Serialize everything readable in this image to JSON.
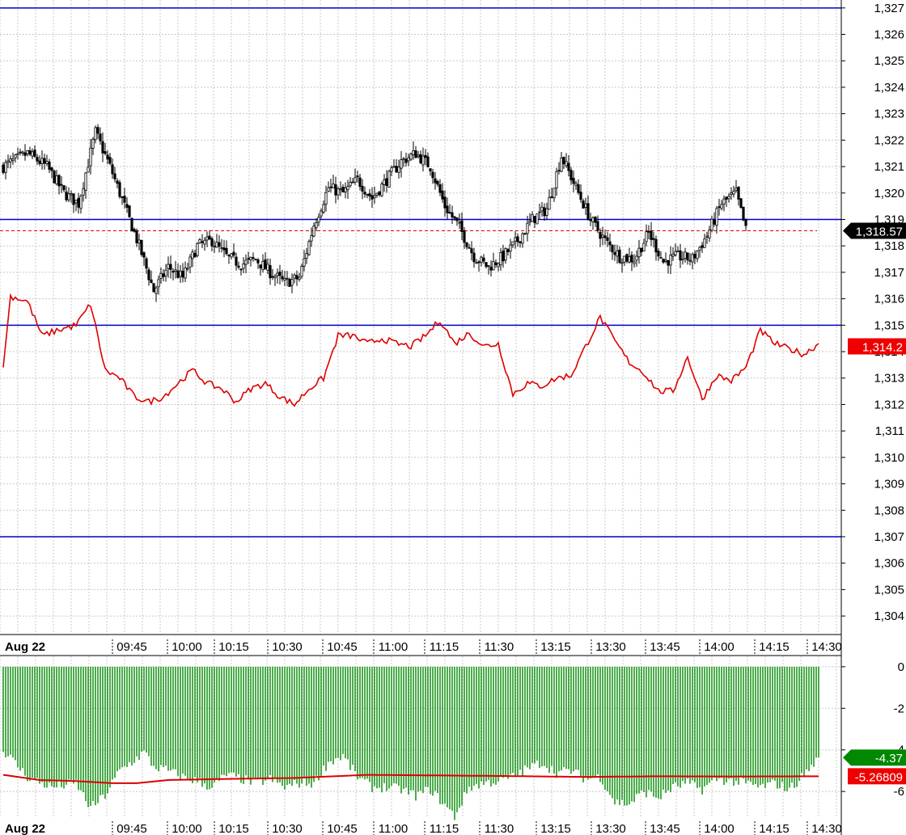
{
  "colors": {
    "grid": "#c8c8c8",
    "level_line": "#0000cc",
    "candle": "#000000",
    "price_line": "#dd0000",
    "volume_bar": "#008800",
    "avg_line": "#dd0000"
  },
  "time_axis": {
    "date_label": "Aug 22",
    "labels": [
      "09:45",
      "10:00",
      "10:15",
      "10:30",
      "10:45",
      "11:00",
      "11:15",
      "11:30",
      "13:15",
      "13:30",
      "13:45",
      "14:00",
      "14:15",
      "14:30"
    ]
  },
  "chart_data": [
    {
      "type": "candlestick",
      "y_ticks": [
        "1,327",
        "1,326",
        "1,325",
        "1,324",
        "1,323",
        "1,322",
        "1,321",
        "1,320",
        "1,319",
        "1,318",
        "1,317",
        "1,316",
        "1,315",
        "1,314",
        "1,313",
        "1,312",
        "1,311",
        "1,310",
        "1,309",
        "1,308",
        "1,307",
        "1,306",
        "1,305",
        "1,304"
      ],
      "ylim": [
        1303.3,
        1327.3
      ],
      "horizontal_levels": [
        1327,
        1319,
        1315,
        1307
      ],
      "dashed_level": 1318.57,
      "price_badge": "1,318.57",
      "line_badge": "1,314.2",
      "close_anchors": [
        [
          0,
          1321.0
        ],
        [
          10,
          1321.5
        ],
        [
          18,
          1321.0
        ],
        [
          25,
          1320.0
        ],
        [
          31,
          1319.6
        ],
        [
          38,
          1322.3
        ],
        [
          44,
          1321.0
        ],
        [
          50,
          1319.5
        ],
        [
          56,
          1318.0
        ],
        [
          62,
          1316.3
        ],
        [
          68,
          1317.2
        ],
        [
          74,
          1316.8
        ],
        [
          80,
          1318.0
        ],
        [
          86,
          1318.2
        ],
        [
          92,
          1317.6
        ],
        [
          98,
          1317.3
        ],
        [
          104,
          1317.5
        ],
        [
          110,
          1317.0
        ],
        [
          116,
          1316.6
        ],
        [
          122,
          1316.8
        ],
        [
          128,
          1318.8
        ],
        [
          134,
          1320.2
        ],
        [
          140,
          1320.0
        ],
        [
          146,
          1320.5
        ],
        [
          152,
          1319.8
        ],
        [
          158,
          1320.5
        ],
        [
          164,
          1321.2
        ],
        [
          170,
          1321.5
        ],
        [
          176,
          1321.0
        ],
        [
          182,
          1319.5
        ],
        [
          188,
          1318.7
        ],
        [
          194,
          1317.6
        ],
        [
          200,
          1317.2
        ],
        [
          206,
          1317.6
        ],
        [
          212,
          1318.2
        ],
        [
          218,
          1319.0
        ],
        [
          224,
          1319.4
        ],
        [
          230,
          1321.4
        ],
        [
          236,
          1320.2
        ],
        [
          242,
          1319.0
        ],
        [
          248,
          1318.2
        ],
        [
          254,
          1317.6
        ],
        [
          260,
          1317.5
        ],
        [
          266,
          1318.5
        ],
        [
          272,
          1317.4
        ],
        [
          278,
          1317.6
        ],
        [
          284,
          1317.5
        ],
        [
          290,
          1318.4
        ],
        [
          296,
          1319.6
        ],
        [
          302,
          1320.0
        ],
        [
          306,
          1318.6
        ]
      ],
      "line_series": {
        "name": "",
        "anchors": [
          [
            0,
            1313.4
          ],
          [
            3,
            1316.1
          ],
          [
            10,
            1315.9
          ],
          [
            16,
            1314.6
          ],
          [
            22,
            1314.8
          ],
          [
            30,
            1315.0
          ],
          [
            36,
            1315.8
          ],
          [
            42,
            1313.3
          ],
          [
            48,
            1313.0
          ],
          [
            54,
            1312.3
          ],
          [
            60,
            1312.1
          ],
          [
            66,
            1312.3
          ],
          [
            72,
            1312.8
          ],
          [
            78,
            1313.3
          ],
          [
            84,
            1312.8
          ],
          [
            90,
            1312.6
          ],
          [
            96,
            1312.1
          ],
          [
            102,
            1312.6
          ],
          [
            108,
            1312.8
          ],
          [
            114,
            1312.3
          ],
          [
            120,
            1312.0
          ],
          [
            126,
            1312.6
          ],
          [
            132,
            1313.0
          ],
          [
            138,
            1314.6
          ],
          [
            144,
            1314.6
          ],
          [
            150,
            1314.3
          ],
          [
            156,
            1314.5
          ],
          [
            162,
            1314.3
          ],
          [
            168,
            1314.2
          ],
          [
            174,
            1314.6
          ],
          [
            180,
            1315.2
          ],
          [
            186,
            1314.3
          ],
          [
            192,
            1314.7
          ],
          [
            198,
            1314.2
          ],
          [
            204,
            1314.3
          ],
          [
            210,
            1312.4
          ],
          [
            216,
            1312.8
          ],
          [
            222,
            1312.7
          ],
          [
            228,
            1313.0
          ],
          [
            234,
            1313.1
          ],
          [
            240,
            1314.2
          ],
          [
            246,
            1315.3
          ],
          [
            252,
            1314.4
          ],
          [
            258,
            1313.6
          ],
          [
            264,
            1313.2
          ],
          [
            270,
            1312.5
          ],
          [
            276,
            1312.5
          ],
          [
            282,
            1313.8
          ],
          [
            288,
            1312.2
          ],
          [
            294,
            1313.1
          ],
          [
            300,
            1312.9
          ],
          [
            306,
            1313.4
          ],
          [
            312,
            1314.8
          ],
          [
            318,
            1314.3
          ],
          [
            324,
            1314.1
          ],
          [
            330,
            1313.9
          ],
          [
            336,
            1314.3
          ]
        ]
      }
    },
    {
      "type": "bar",
      "y_ticks": [
        "0",
        "-2",
        "-4",
        "-6"
      ],
      "ylim": [
        -7.2,
        0.5
      ],
      "value_badge": "-4.37",
      "avg_badge": "-5.26809",
      "value_anchors": [
        [
          0,
          -4.0
        ],
        [
          10,
          -5.3
        ],
        [
          20,
          -5.8
        ],
        [
          30,
          -5.6
        ],
        [
          36,
          -6.8
        ],
        [
          42,
          -6.2
        ],
        [
          48,
          -5.0
        ],
        [
          54,
          -4.5
        ],
        [
          58,
          -4.1
        ],
        [
          62,
          -4.8
        ],
        [
          68,
          -5.0
        ],
        [
          74,
          -5.3
        ],
        [
          80,
          -5.5
        ],
        [
          86,
          -5.8
        ],
        [
          92,
          -5.2
        ],
        [
          98,
          -5.4
        ],
        [
          104,
          -5.6
        ],
        [
          110,
          -5.4
        ],
        [
          116,
          -5.8
        ],
        [
          122,
          -5.6
        ],
        [
          128,
          -5.6
        ],
        [
          134,
          -4.6
        ],
        [
          140,
          -4.3
        ],
        [
          146,
          -5.3
        ],
        [
          152,
          -5.8
        ],
        [
          158,
          -5.8
        ],
        [
          164,
          -5.9
        ],
        [
          170,
          -6.2
        ],
        [
          176,
          -5.9
        ],
        [
          180,
          -6.4
        ],
        [
          186,
          -7.2
        ],
        [
          192,
          -5.8
        ],
        [
          198,
          -5.6
        ],
        [
          204,
          -5.5
        ],
        [
          210,
          -5.3
        ],
        [
          216,
          -4.9
        ],
        [
          222,
          -4.6
        ],
        [
          228,
          -5.1
        ],
        [
          234,
          -5.0
        ],
        [
          240,
          -5.4
        ],
        [
          246,
          -5.3
        ],
        [
          252,
          -6.5
        ],
        [
          258,
          -6.6
        ],
        [
          264,
          -6.0
        ],
        [
          270,
          -6.3
        ],
        [
          276,
          -5.8
        ],
        [
          282,
          -5.6
        ],
        [
          288,
          -5.9
        ],
        [
          294,
          -5.4
        ],
        [
          300,
          -5.5
        ],
        [
          306,
          -5.6
        ],
        [
          312,
          -5.8
        ],
        [
          318,
          -5.6
        ],
        [
          324,
          -5.9
        ],
        [
          330,
          -5.2
        ],
        [
          336,
          -4.37
        ]
      ],
      "avg_line": {
        "name": "",
        "anchors": [
          [
            0,
            -5.2
          ],
          [
            15,
            -5.45
          ],
          [
            30,
            -5.5
          ],
          [
            45,
            -5.6
          ],
          [
            55,
            -5.6
          ],
          [
            68,
            -5.45
          ],
          [
            90,
            -5.4
          ],
          [
            120,
            -5.35
          ],
          [
            150,
            -5.2
          ],
          [
            200,
            -5.25
          ],
          [
            240,
            -5.3
          ],
          [
            270,
            -5.27
          ],
          [
            300,
            -5.28
          ],
          [
            336,
            -5.27
          ]
        ]
      }
    }
  ]
}
